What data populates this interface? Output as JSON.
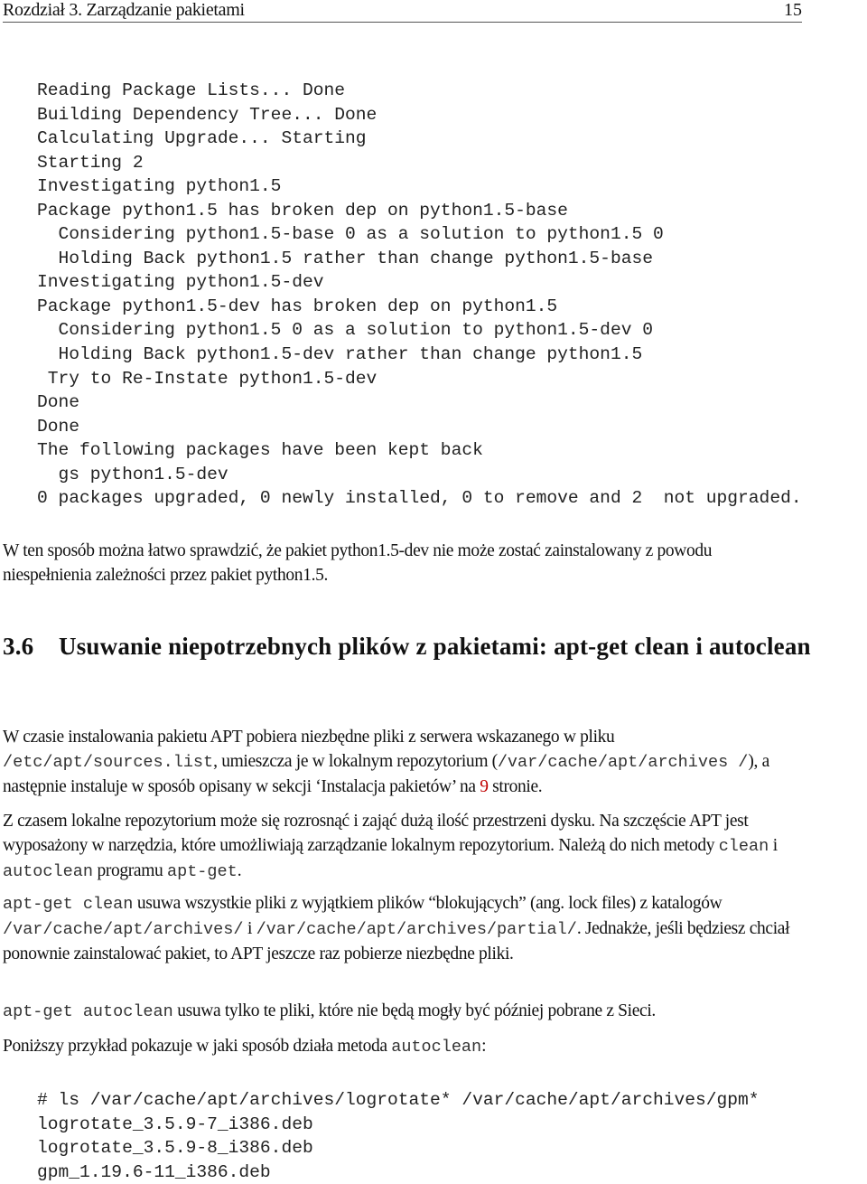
{
  "header": {
    "chapter": "Rozdział 3. Zarządzanie pakietami",
    "page_number": "15"
  },
  "terminal_output": [
    "Reading Package Lists... Done",
    "Building Dependency Tree... Done",
    "Calculating Upgrade... Starting",
    "Starting 2",
    "Investigating python1.5",
    "Package python1.5 has broken dep on python1.5-base",
    "  Considering python1.5-base 0 as a solution to python1.5 0",
    "  Holding Back python1.5 rather than change python1.5-base",
    "Investigating python1.5-dev",
    "Package python1.5-dev has broken dep on python1.5",
    "  Considering python1.5 0 as a solution to python1.5-dev 0",
    "  Holding Back python1.5-dev rather than change python1.5",
    " Try to Re-Instate python1.5-dev",
    "Done",
    "Done",
    "The following packages have been kept back",
    "  gs python1.5-dev",
    "0 packages upgraded, 0 newly installed, 0 to remove and 2  not upgraded."
  ],
  "para_check": "W ten sposób można łatwo sprawdzić, że pakiet python1.5-dev nie może zostać zainstalowany z powodu niespełnienia zależności przez pakiet python1.5.",
  "section": {
    "number": "3.6",
    "title": "Usuwanie niepotrzebnych plików z pakietami: apt-get clean i autoclean"
  },
  "para_intro": {
    "t1": "W czasie instalowania pakietu APT pobiera niezbędne pliki z serwera wskazanego w pliku ",
    "c1": "/etc/apt/sources.list",
    "t2": ", umieszcza je w lokalnym repozytorium (",
    "c2": "/var/cache/apt/archives /",
    "t3": "), a następnie instaluje w sposób opisany w sekcji ‘Instalacja pakietów’ na ",
    "ref": "9",
    "t4": " stronie."
  },
  "para_repo": {
    "t1": "Z czasem lokalne repozytorium może się rozrosnąć i zająć dużą ilość przestrzeni dysku.  Na szczęście APT jest wyposażony w narzędzia, które umożliwiają zarządzanie lokalnym repozy­torium. Należą do nich metody ",
    "c1": "clean",
    "t2": " i ",
    "c2": "autoclean",
    "t3": " programu ",
    "c3": "apt-get",
    "t4": "."
  },
  "para_clean": {
    "c1": "apt-get clean",
    "t1": " usuwa wszystkie pliki z wyjątkiem plików “blokujących” (ang. lock files) z katalogów ",
    "c2": "/var/cache/apt/archives/",
    "t2": " i ",
    "c3": "/var/cache/apt/archives/partial/",
    "t3": ". Jed­nakże, jeśli będziesz chciał ponownie zainstalować pakiet, to APT jeszcze raz pobierze niezbędne pliki."
  },
  "para_autoclean": {
    "c1": "apt-get autoclean",
    "t1": " usuwa tylko te pliki, które nie będą mogły być później pobrane z Sieci."
  },
  "para_example": {
    "t1": "Poniższy przykład pokazuje w jaki sposób działa metoda ",
    "c1": "autoclean",
    "t2": ":"
  },
  "ls_example": [
    "# ls /var/cache/apt/archives/logrotate* /var/cache/apt/archives/gpm*",
    "logrotate_3.5.9-7_i386.deb",
    "logrotate_3.5.9-8_i386.deb",
    "gpm_1.19.6-11_i386.deb"
  ],
  "colors": {
    "reference_link": "#c00000"
  }
}
